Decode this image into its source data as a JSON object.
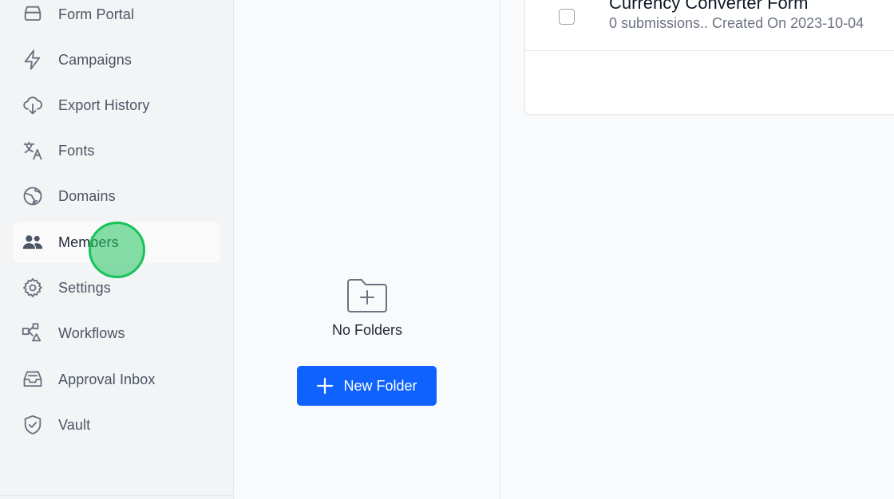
{
  "sidebar": {
    "items": [
      {
        "label": "Form Portal",
        "icon": "stack-icon"
      },
      {
        "label": "Campaigns",
        "icon": "bolt-icon"
      },
      {
        "label": "Export History",
        "icon": "cloud-download-icon"
      },
      {
        "label": "Fonts",
        "icon": "translate-icon"
      },
      {
        "label": "Domains",
        "icon": "globe-icon"
      },
      {
        "label": "Members",
        "icon": "users-icon",
        "active": true
      },
      {
        "label": "Settings",
        "icon": "gear-icon"
      },
      {
        "label": "Workflows",
        "icon": "workflow-icon"
      },
      {
        "label": "Approval Inbox",
        "icon": "inbox-icon"
      },
      {
        "label": "Vault",
        "icon": "shield-check-icon"
      }
    ]
  },
  "folders": {
    "empty_title": "No Folders",
    "new_folder_label": "New Folder"
  },
  "forms": {
    "items": [
      {
        "title": "Currency Converter Form",
        "meta": "0 submissions.. Created On 2023-10-04"
      }
    ]
  },
  "colors": {
    "accent": "#0f62fe",
    "click_indicator": "#16c35a"
  }
}
